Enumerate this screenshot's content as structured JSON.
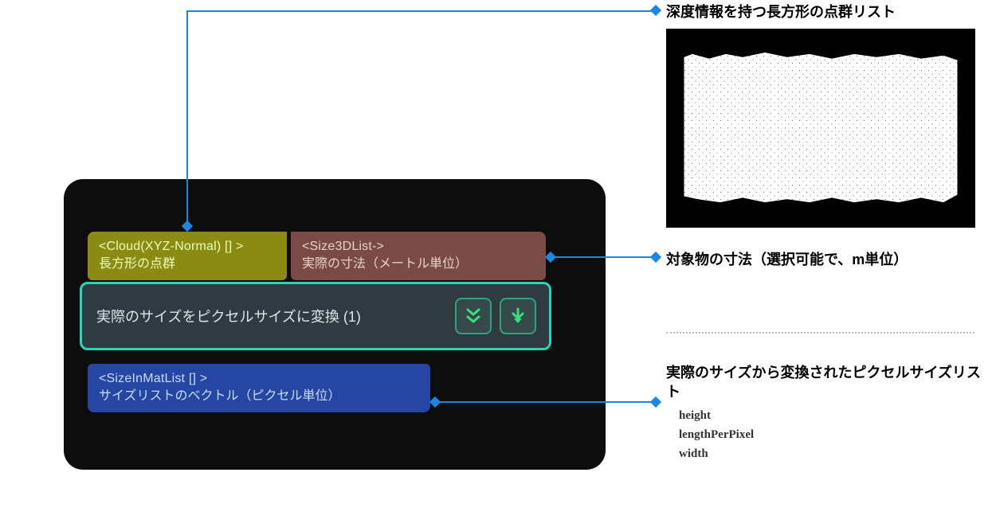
{
  "annotations": {
    "top": "深度情報を持つ長方形の点群リスト",
    "mid": "対象物の寸法（選択可能で、m単位）",
    "bottom_title": "実際のサイズから変換されたピクセルサイズリスト",
    "bottom_fields": {
      "f1": "height",
      "f2": "lengthPerPixel",
      "f3": "width"
    }
  },
  "node": {
    "title": "実際のサイズをピクセルサイズに変換 (1)",
    "inputs": {
      "cloud": {
        "type": "<Cloud(XYZ-Normal) [] >",
        "label": "長方形の点群"
      },
      "size3d": {
        "type": "<Size3DList->",
        "label": "実際の寸法（メートル単位）"
      }
    },
    "outputs": {
      "pixel_list": {
        "type": "<SizeInMatList [] >",
        "label": "サイズリストのベクトル（ピクセル単位）"
      }
    }
  },
  "icons": {
    "expand_all": "double-chevron-down-icon",
    "run": "arrow-down-icon"
  }
}
